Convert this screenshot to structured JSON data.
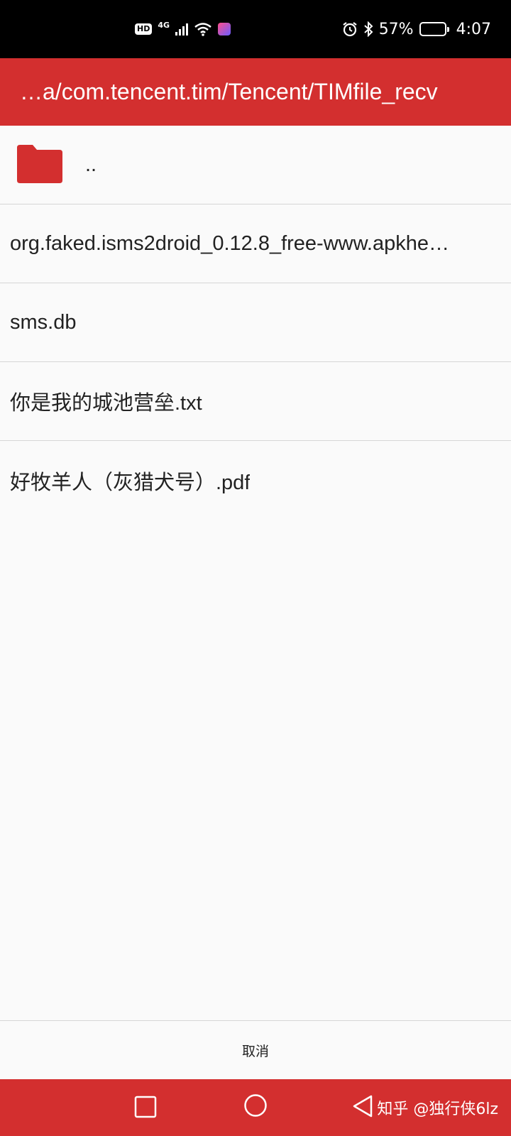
{
  "status_bar": {
    "hd_badge": "HD",
    "network": "4G",
    "battery_percent": "57%",
    "battery_level": 0.57,
    "time": "4:07"
  },
  "title_bar": {
    "path": "…a/com.tencent.tim/Tencent/TIMfile_recv"
  },
  "file_list": {
    "parent_dir": "..",
    "files": [
      "org.faked.isms2droid_0.12.8_free-www.apkhe…",
      "sms.db",
      "你是我的城池营垒.txt",
      "好牧羊人（灰猎犬号）.pdf"
    ]
  },
  "actions": {
    "cancel_label": "取消"
  },
  "watermark": {
    "text": "知乎 @独行侠6lz"
  },
  "colors": {
    "accent": "#d32f2f",
    "background": "#fafafa",
    "divider": "#d6d6d6"
  },
  "icons": {
    "folder": "folder-icon",
    "nav_recent": "square-icon",
    "nav_home": "circle-icon",
    "nav_back": "triangle-back-icon"
  }
}
